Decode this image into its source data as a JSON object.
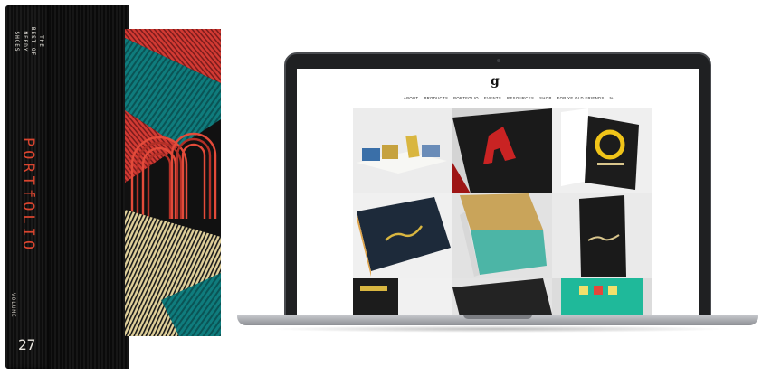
{
  "book": {
    "spine_title": "THE BEST OF NERDY SHOES",
    "spine_word": "PORTfOLIO",
    "volume_label": "VOLUME",
    "volume_number": "27"
  },
  "site": {
    "logo_glyph": "g",
    "nav": [
      "ABOUT",
      "PRODUCTS",
      "PORTFOLIO",
      "EVENTS",
      "RESOURCES",
      "SHOP",
      "FOR YE OLD FRIENDS",
      "%"
    ]
  },
  "colors": {
    "accent_red": "#d9452f",
    "teal": "#0f7c7d",
    "gold": "#d8c58c",
    "laptop_body": "#1f2022"
  },
  "icons": [
    "laptop-camera-icon"
  ]
}
